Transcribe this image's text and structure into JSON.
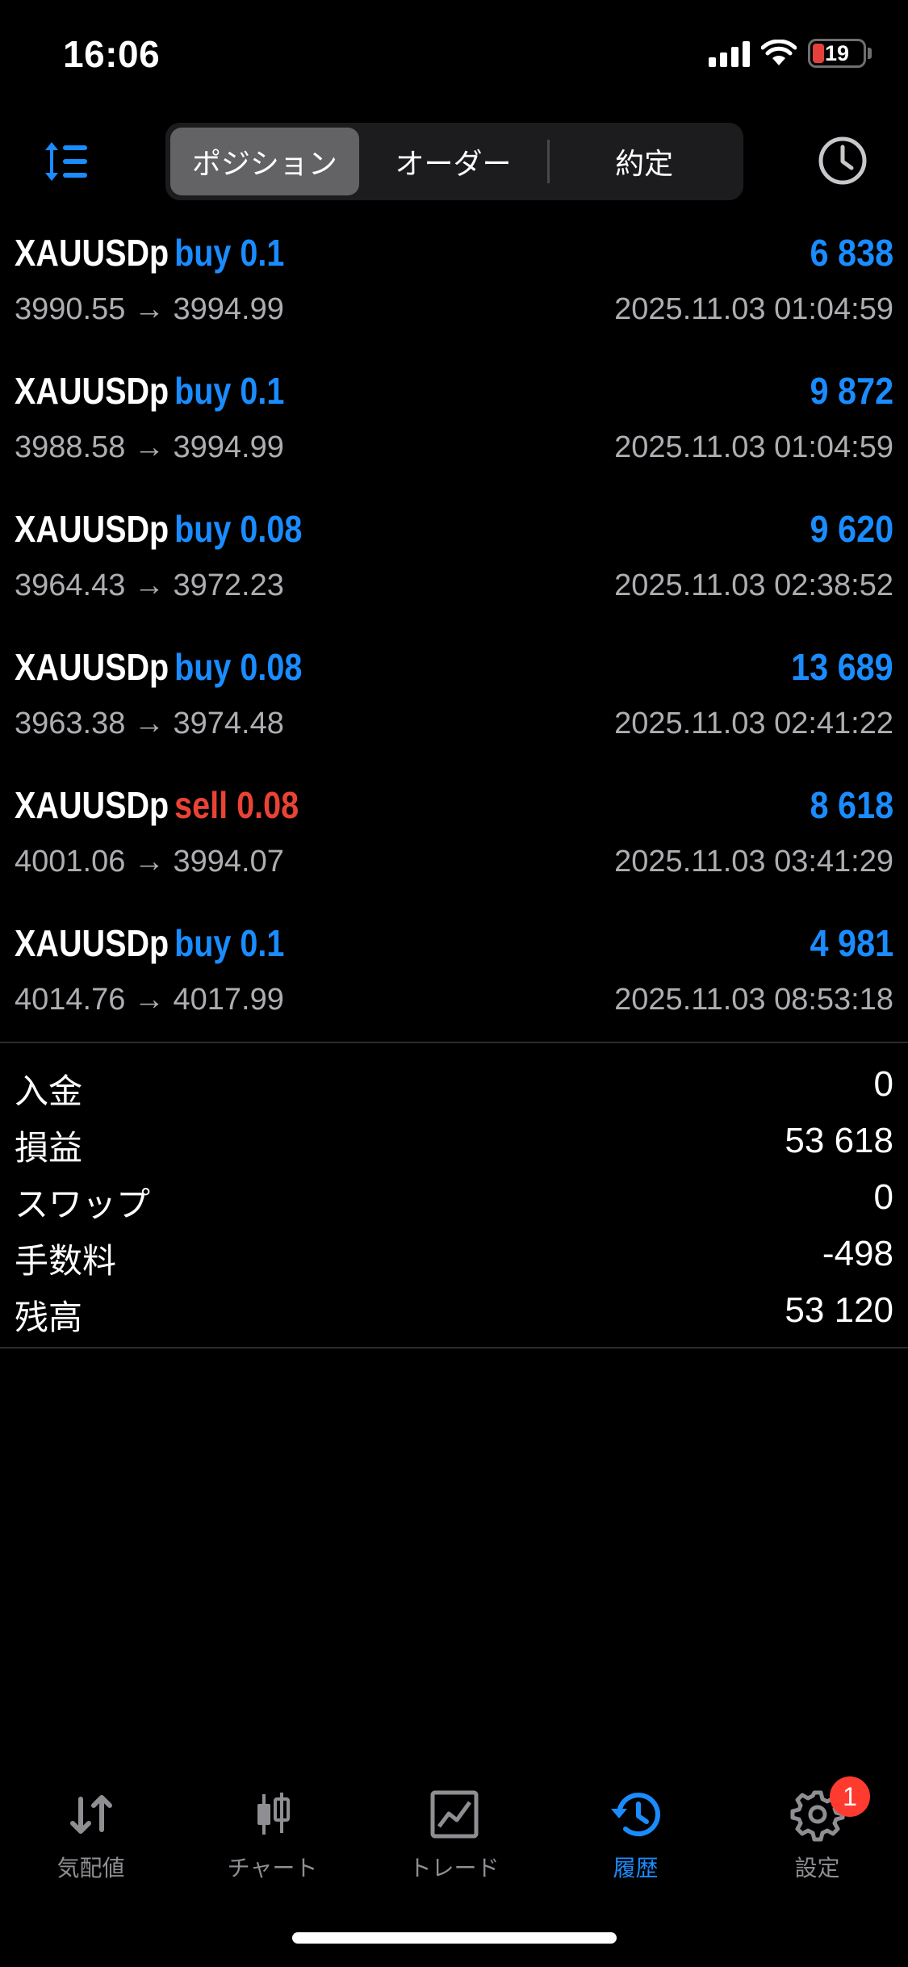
{
  "status": {
    "time": "16:06",
    "battery": "19"
  },
  "header": {
    "tabs": [
      {
        "label": "ポジション"
      },
      {
        "label": "オーダー"
      },
      {
        "label": "約定"
      }
    ]
  },
  "deals": [
    {
      "symbol": "XAUUSDp",
      "direction": "buy",
      "volume_label": "buy 0.1",
      "profit": "6 838",
      "prices": "3990.55 → 3994.99",
      "time": "2025.11.03 01:04:59"
    },
    {
      "symbol": "XAUUSDp",
      "direction": "buy",
      "volume_label": "buy 0.1",
      "profit": "9 872",
      "prices": "3988.58 → 3994.99",
      "time": "2025.11.03 01:04:59"
    },
    {
      "symbol": "XAUUSDp",
      "direction": "buy",
      "volume_label": "buy 0.08",
      "profit": "9 620",
      "prices": "3964.43 → 3972.23",
      "time": "2025.11.03 02:38:52"
    },
    {
      "symbol": "XAUUSDp",
      "direction": "buy",
      "volume_label": "buy 0.08",
      "profit": "13 689",
      "prices": "3963.38 → 3974.48",
      "time": "2025.11.03 02:41:22"
    },
    {
      "symbol": "XAUUSDp",
      "direction": "sell",
      "volume_label": "sell 0.08",
      "profit": "8 618",
      "prices": "4001.06 → 3994.07",
      "time": "2025.11.03 03:41:29"
    },
    {
      "symbol": "XAUUSDp",
      "direction": "buy",
      "volume_label": "buy 0.1",
      "profit": "4 981",
      "prices": "4014.76 → 4017.99",
      "time": "2025.11.03 08:53:18"
    }
  ],
  "summary": [
    {
      "label": "入金",
      "value": "0"
    },
    {
      "label": "損益",
      "value": "53 618"
    },
    {
      "label": "スワップ",
      "value": "0"
    },
    {
      "label": "手数料",
      "value": "-498"
    },
    {
      "label": "残高",
      "value": "53 120"
    }
  ],
  "tabbar": {
    "items": [
      {
        "label": "気配値",
        "icon": "arrows-up-down-icon"
      },
      {
        "label": "チャート",
        "icon": "candlestick-icon"
      },
      {
        "label": "トレード",
        "icon": "trade-chart-icon"
      },
      {
        "label": "履歴",
        "icon": "history-icon"
      },
      {
        "label": "設定",
        "icon": "gear-icon",
        "badge": "1"
      }
    ]
  },
  "colors": {
    "accent": "#1a8cff",
    "sell": "#ea4335",
    "muted": "#aeaeb2"
  }
}
